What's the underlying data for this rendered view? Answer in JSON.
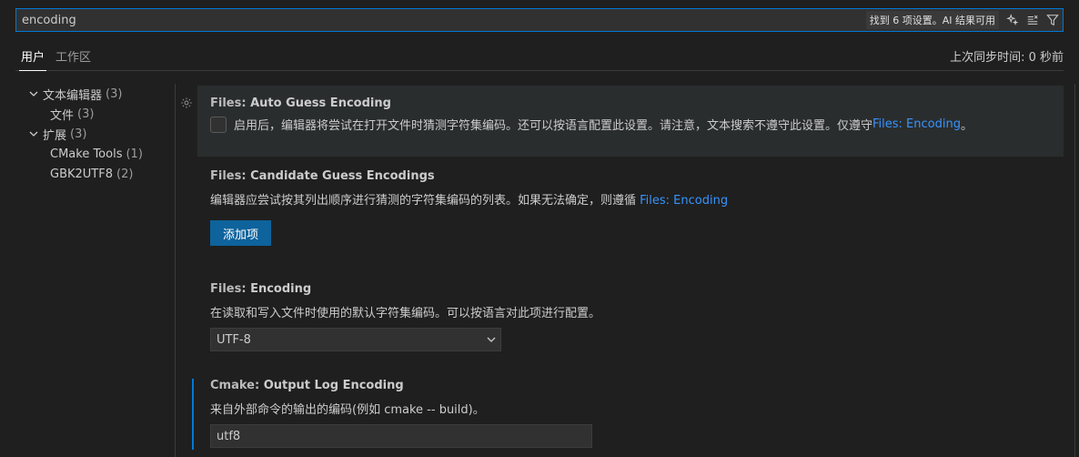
{
  "search": {
    "value": "encoding",
    "result_text": "找到 6 项设置。AI 结果可用"
  },
  "toolbar": {
    "ai_icon": "sparkle-icon",
    "clear_icon": "clear-filter-icon",
    "filter_icon": "filter-icon"
  },
  "tabs": [
    {
      "label": "用户",
      "active": true
    },
    {
      "label": "工作区",
      "active": false
    }
  ],
  "sync_status": "上次同步时间: 0 秒前",
  "toc": [
    {
      "label": "文本编辑器",
      "count": "(3)",
      "expanded": true,
      "level": 1
    },
    {
      "label": "文件",
      "count": "(3)",
      "level": 2
    },
    {
      "label": "扩展",
      "count": "(3)",
      "expanded": true,
      "level": 1
    },
    {
      "label": "CMake Tools",
      "count": "(1)",
      "level": 2
    },
    {
      "label": "GBK2UTF8",
      "count": "(2)",
      "level": 2
    }
  ],
  "settings": {
    "auto_guess": {
      "category": "Files: ",
      "name": "Auto Guess Encoding",
      "desc": "启用后，编辑器将尝试在打开文件时猜测字符集编码。还可以按语言配置此设置。请注意，文本搜索不遵守此设置。仅遵守 ",
      "link": "Files: Encoding",
      "desc_suffix": "。",
      "checked": false
    },
    "candidate": {
      "category": "Files: ",
      "name": "Candidate Guess Encodings",
      "desc": "编辑器应尝试按其列出顺序进行猜测的字符集编码的列表。如果无法确定，则遵循 ",
      "link": "Files: Encoding",
      "button": "添加项"
    },
    "encoding": {
      "category": "Files: ",
      "name": "Encoding",
      "desc": "在读取和写入文件时使用的默认字符集编码。可以按语言对此项进行配置。",
      "value": "UTF-8"
    },
    "cmake": {
      "category": "Cmake: ",
      "name": "Output Log Encoding",
      "desc": "来自外部命令的输出的编码(例如 cmake -- build)。",
      "value": "utf8"
    }
  },
  "colors": {
    "accent": "#0078d4",
    "link": "#3794ff",
    "button": "#0e639c",
    "background": "#1f1f1f"
  }
}
